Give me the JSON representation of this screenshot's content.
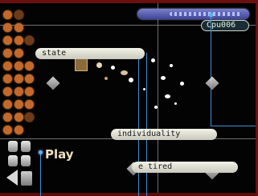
{
  "labels": {
    "state": "state",
    "individuality": "individuality",
    "tired": "e tired"
  },
  "player_tag": "Cpu006",
  "play_label": "Play",
  "colors": {
    "connector": "#3a8fd6",
    "dot": "#c4692b",
    "gauge": "#5a62b8",
    "frame": "#6b0f10"
  }
}
